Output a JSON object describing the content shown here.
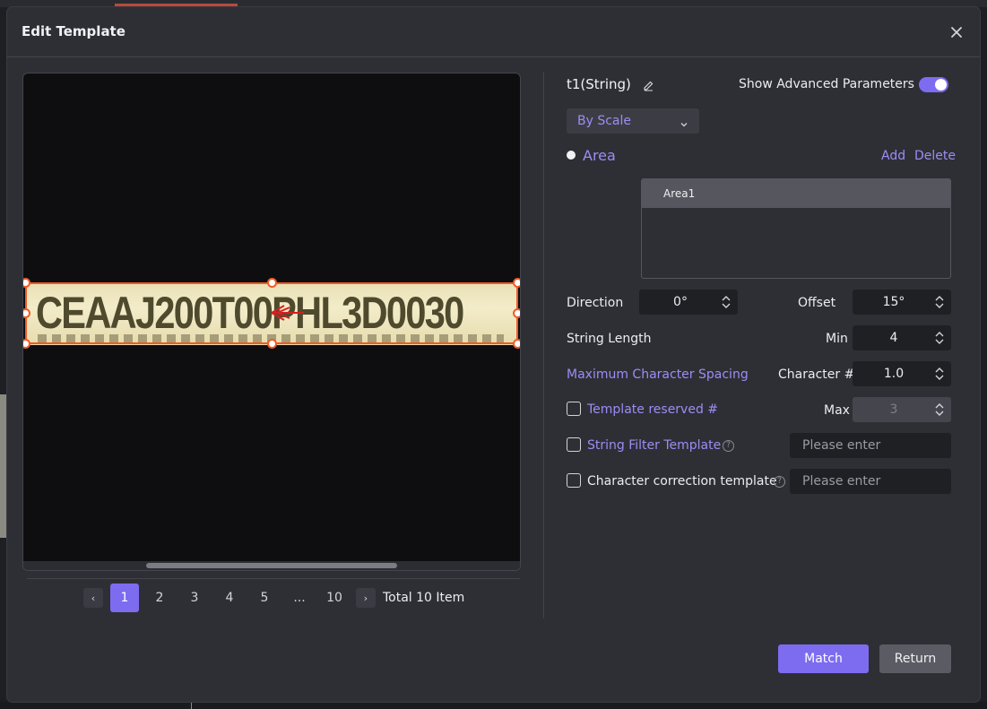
{
  "dialog": {
    "title": "Edit Template"
  },
  "preview": {
    "plate_text": "CEAAJ200T00PHL3D0030",
    "pagination": {
      "pages": [
        "1",
        "2",
        "3",
        "4",
        "5",
        "...",
        "10"
      ],
      "active_page": "1",
      "prev": "‹",
      "next": "›",
      "total_label": "Total 10 Item"
    }
  },
  "template": {
    "name": "t1(String)",
    "advanced_label": "Show Advanced Parameters",
    "advanced_enabled": true,
    "mode_select": "By Scale",
    "area_label": "Area",
    "add_label": "Add",
    "delete_label": "Delete",
    "areas": [
      "Area1"
    ],
    "direction_label": "Direction",
    "direction_value": "0°",
    "offset_label": "Offset",
    "offset_value": "15°",
    "string_length_label": "String Length",
    "min_label": "Min",
    "min_value": "4",
    "max_char_spacing_label": "Maximum Character Spacing",
    "character_label": "Character #",
    "character_value": "1.0",
    "template_reserved_label": "Template reserved #",
    "max_label": "Max",
    "max_value": "3",
    "string_filter_label": "String Filter Template",
    "char_correction_label": "Character correction template",
    "placeholder": "Please enter"
  },
  "buttons": {
    "match": "Match",
    "return": "Return"
  },
  "colors": {
    "accent": "#7d6cf0",
    "selection": "#f05a28",
    "background": "#2e2f35"
  }
}
